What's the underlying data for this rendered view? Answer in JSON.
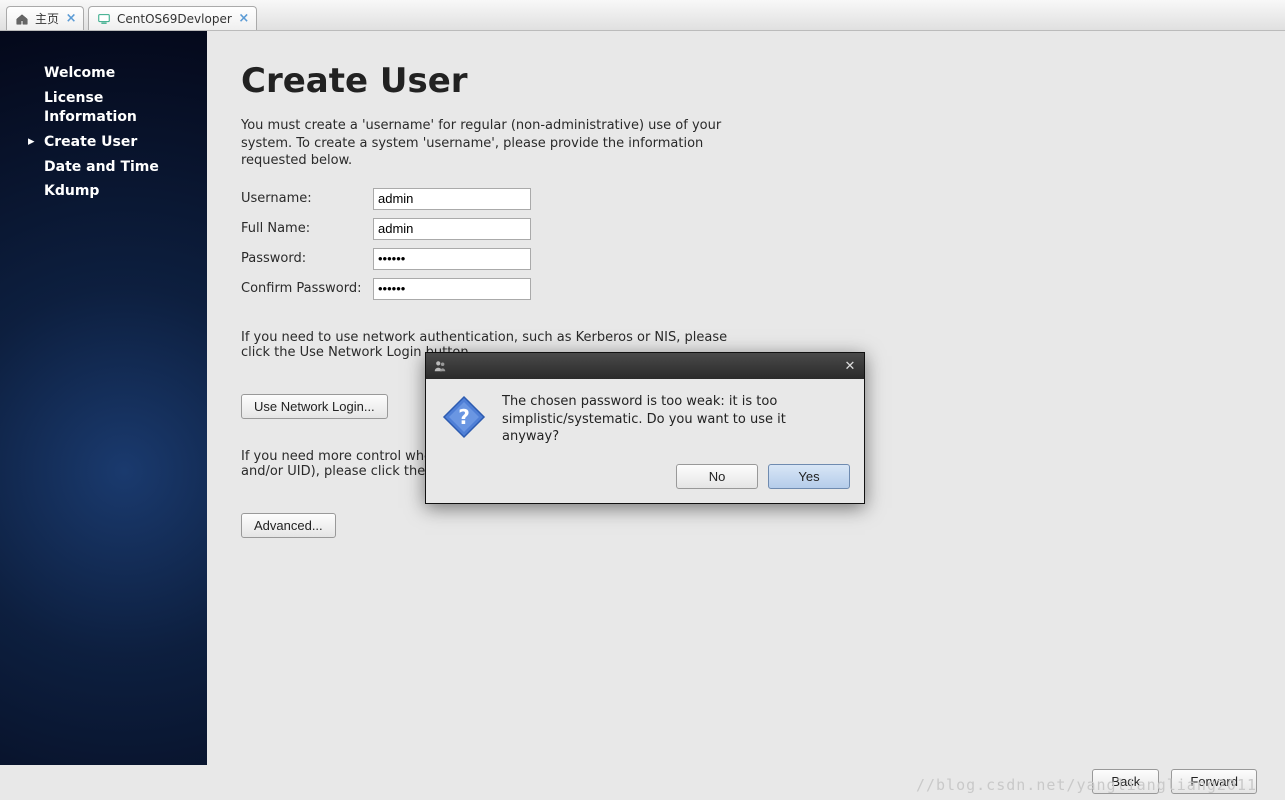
{
  "tabs": [
    {
      "label": "主页",
      "icon": "home"
    },
    {
      "label": "CentOS69Devloper",
      "icon": "vm"
    }
  ],
  "sidebar": {
    "items": [
      {
        "label": "Welcome"
      },
      {
        "label": "License Information"
      },
      {
        "label": "Create User",
        "active": true
      },
      {
        "label": "Date and Time"
      },
      {
        "label": "Kdump"
      }
    ]
  },
  "page": {
    "title": "Create User",
    "description": "You must create a 'username' for regular (non-administrative) use of your system.  To create a system 'username', please provide the information requested below.",
    "labels": {
      "username": "Username:",
      "fullname": "Full Name:",
      "password": "Password:",
      "confirm": "Confirm Password:"
    },
    "values": {
      "username": "admin",
      "fullname": "admin",
      "password": "••••••",
      "confirm": "••••••"
    },
    "network_text": "If you need to use network authentication, such as Kerberos or NIS, please click the Use Network Login button.",
    "network_button": "Use Network Login...",
    "advanced_text": "If you need more control when creating the user (specifying home directory, and/or UID), please click the Advanced button.",
    "advanced_button": "Advanced...",
    "footer": {
      "back": "Back",
      "forward": "Forward"
    }
  },
  "dialog": {
    "message": "The chosen password is too weak: it is too simplistic/systematic. Do you want to use it anyway?",
    "no": "No",
    "yes": "Yes"
  },
  "watermark": "//blog.csdn.net/yangliangliang2011"
}
